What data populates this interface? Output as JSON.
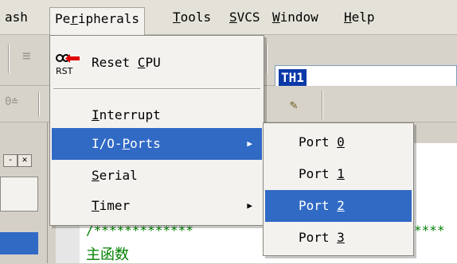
{
  "menubar": {
    "items": [
      {
        "label": "ash",
        "key": ""
      },
      {
        "label": "Peripherals",
        "key": "r"
      },
      {
        "label": "Tools",
        "key": "T"
      },
      {
        "label": "SVCS",
        "key": "S"
      },
      {
        "label": "Window",
        "key": "W"
      },
      {
        "label": "Help",
        "key": "H"
      }
    ]
  },
  "toolbar": {
    "field_value": "TH1"
  },
  "peripherals_menu": {
    "reset": {
      "label": "Reset CPU",
      "key": "C",
      "icon": "rst-icon",
      "icon_text": "RST"
    },
    "interrupt": {
      "label": "Interrupt",
      "key": "I"
    },
    "io_ports": {
      "label": "I/O-Ports",
      "key": "P"
    },
    "serial": {
      "label": "Serial",
      "key": "S"
    },
    "timer": {
      "label": "Timer",
      "key": "T"
    }
  },
  "ports_submenu": {
    "items": [
      {
        "label": "Port 0",
        "key": "0"
      },
      {
        "label": "Port 1",
        "key": "1"
      },
      {
        "label": "Port 2",
        "key": "2"
      },
      {
        "label": "Port 3",
        "key": "3"
      }
    ],
    "highlighted": "Port 2"
  },
  "editor": {
    "comment_left": "/*************",
    "comment_right": "****",
    "line2": "主函数"
  },
  "colors": {
    "highlight": "#316ac5",
    "comment": "#008000",
    "menu_bg": "#f4f2ee"
  }
}
